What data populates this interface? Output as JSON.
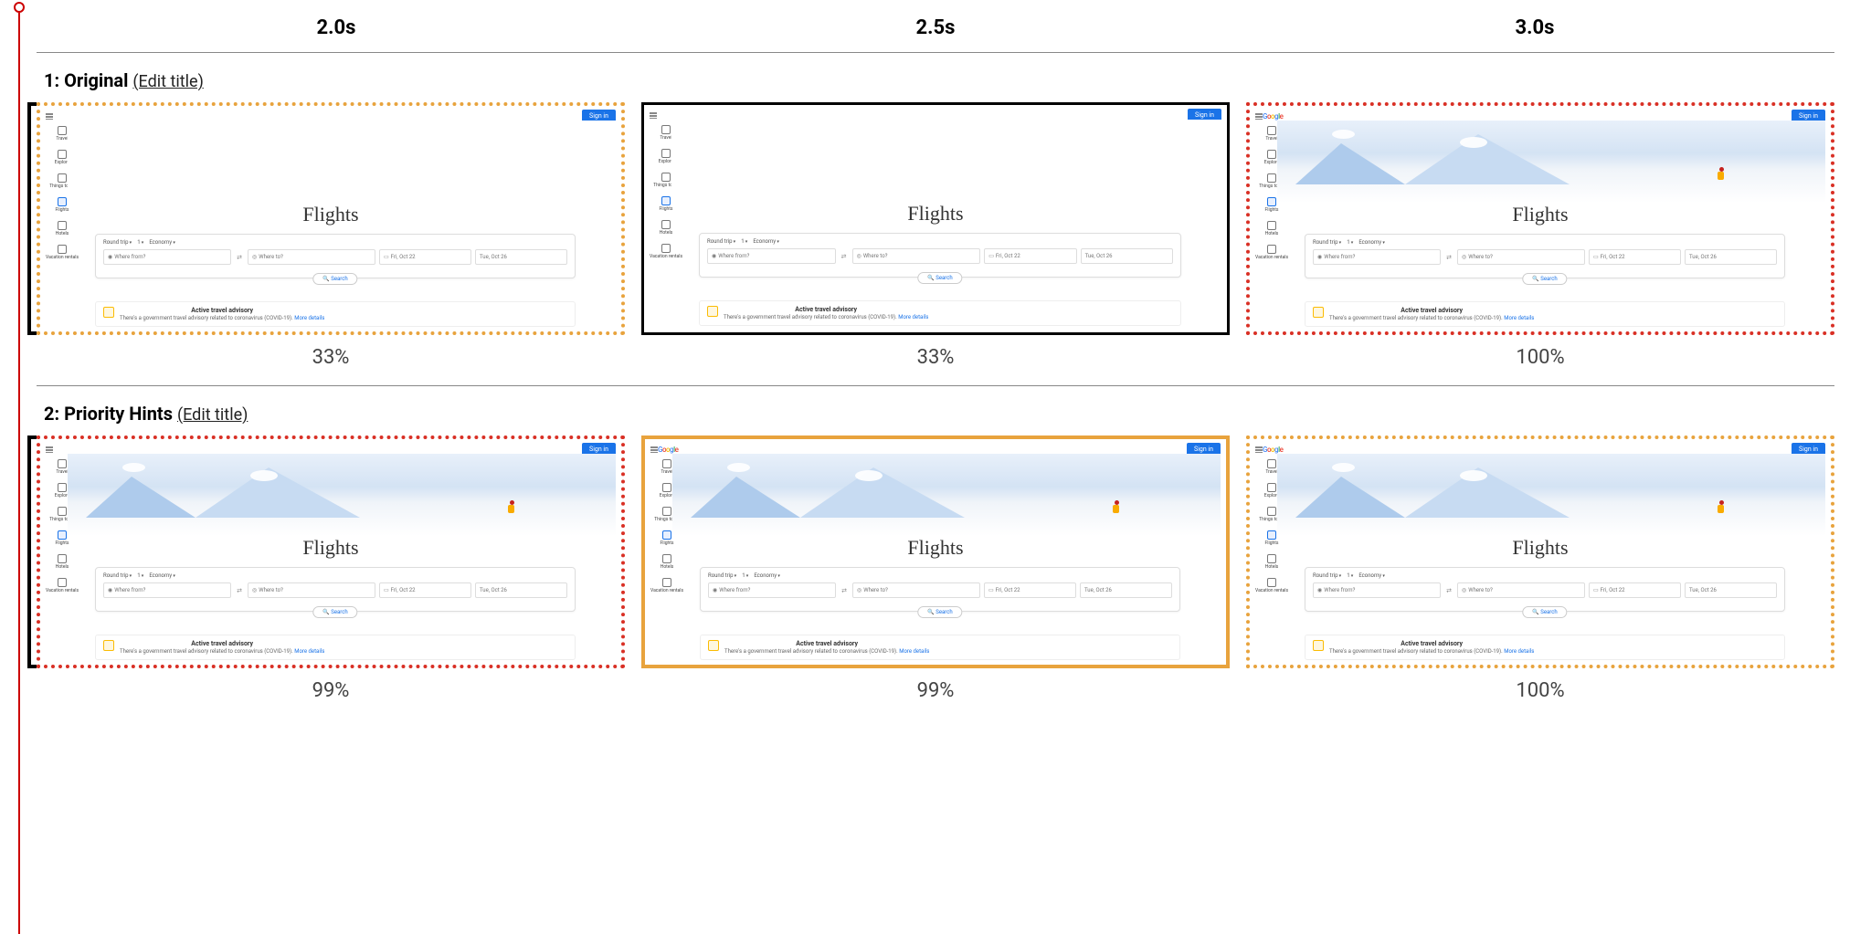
{
  "time_headers": [
    "2.0s",
    "2.5s",
    "3.0s"
  ],
  "rows": [
    {
      "num": "1:",
      "title": "Original",
      "edit_label": "(Edit title)",
      "cells": [
        {
          "percent": "33%",
          "border": "border-dotted-orange",
          "hero": false,
          "logo": false,
          "tab": true
        },
        {
          "percent": "33%",
          "border": "border-solid-black",
          "hero": false,
          "logo": false,
          "tab": false
        },
        {
          "percent": "100%",
          "border": "border-dotted-red",
          "hero": true,
          "logo": true,
          "tab": false
        }
      ]
    },
    {
      "num": "2:",
      "title": "Priority Hints",
      "edit_label": "(Edit title)",
      "cells": [
        {
          "percent": "99%",
          "border": "border-dotted-red",
          "hero": true,
          "logo": false,
          "tab": true
        },
        {
          "percent": "99%",
          "border": "border-solid-orange",
          "hero": true,
          "logo": true,
          "tab": false
        },
        {
          "percent": "100%",
          "border": "border-dotted-orange",
          "hero": true,
          "logo": true,
          "tab": false
        }
      ]
    }
  ],
  "gf": {
    "signin": "Sign in",
    "logo": "Google",
    "title": "Flights",
    "side_items": [
      "Travel",
      "Explore",
      "Things to do",
      "Flights",
      "Hotels",
      "Vacation rentals"
    ],
    "chips": [
      "Round trip",
      "1",
      "Economy"
    ],
    "where_from": "Where from?",
    "where_to": "Where to?",
    "date_from": "Fri, Oct 22",
    "date_to": "Tue, Oct 26",
    "search": "Search",
    "advisory_title": "Active travel advisory",
    "advisory_body": "There's a government travel advisory related to coronavirus (COVID-19).",
    "advisory_link": "More details"
  }
}
